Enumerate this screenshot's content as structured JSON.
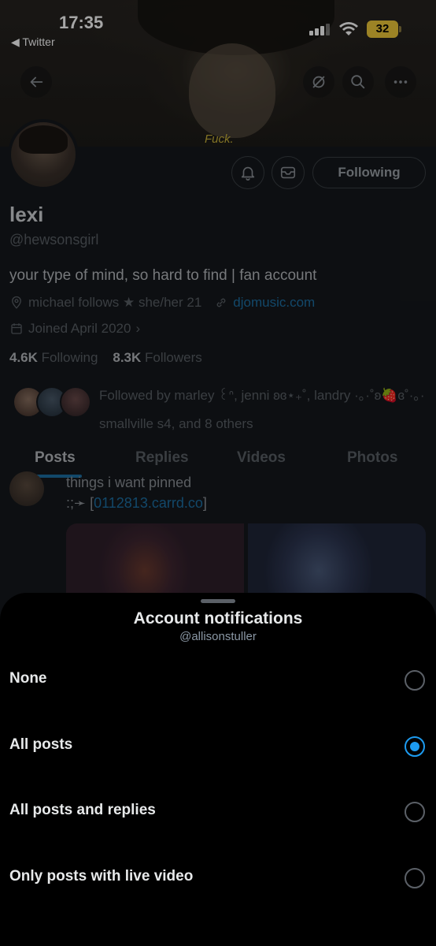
{
  "status_bar": {
    "time": "17:35",
    "back_app": "◀ Twitter",
    "battery": "32"
  },
  "banner": {
    "caption": "Fuck."
  },
  "profile": {
    "display_name": "lexi",
    "handle": "@hewsonsgirl",
    "bio": "your type of mind, so hard to find | fan account",
    "location": "michael follows ★ she/her 21",
    "website": "djomusic.com",
    "joined": "Joined April 2020",
    "following_count": "4.6K",
    "following_label": "Following",
    "followers_count": "8.3K",
    "followers_label": "Followers",
    "followed_by": "Followed by marley ꒰ᐢ, jenni ʚɞ⋆₊˚, landry ·｡·˚ʚ🍓ɞ˚·｡· smallville s4, and 8 others",
    "follow_button": "Following"
  },
  "tabs": [
    "Posts",
    "Replies",
    "Videos",
    "Photos"
  ],
  "pinned_post": {
    "text": "things i want pinned",
    "link_prefix": ":;➛ [",
    "link": "0112813.carrd.co",
    "link_suffix": "]"
  },
  "sheet": {
    "title": "Account notifications",
    "subtitle": "@allisonstuller",
    "options": [
      {
        "label": "None",
        "selected": false
      },
      {
        "label": "All posts",
        "selected": true
      },
      {
        "label": "All posts and replies",
        "selected": false
      },
      {
        "label": "Only posts with live video",
        "selected": false
      }
    ]
  },
  "colors": {
    "accent": "#1d9bf0",
    "battery": "#f0c93a"
  }
}
